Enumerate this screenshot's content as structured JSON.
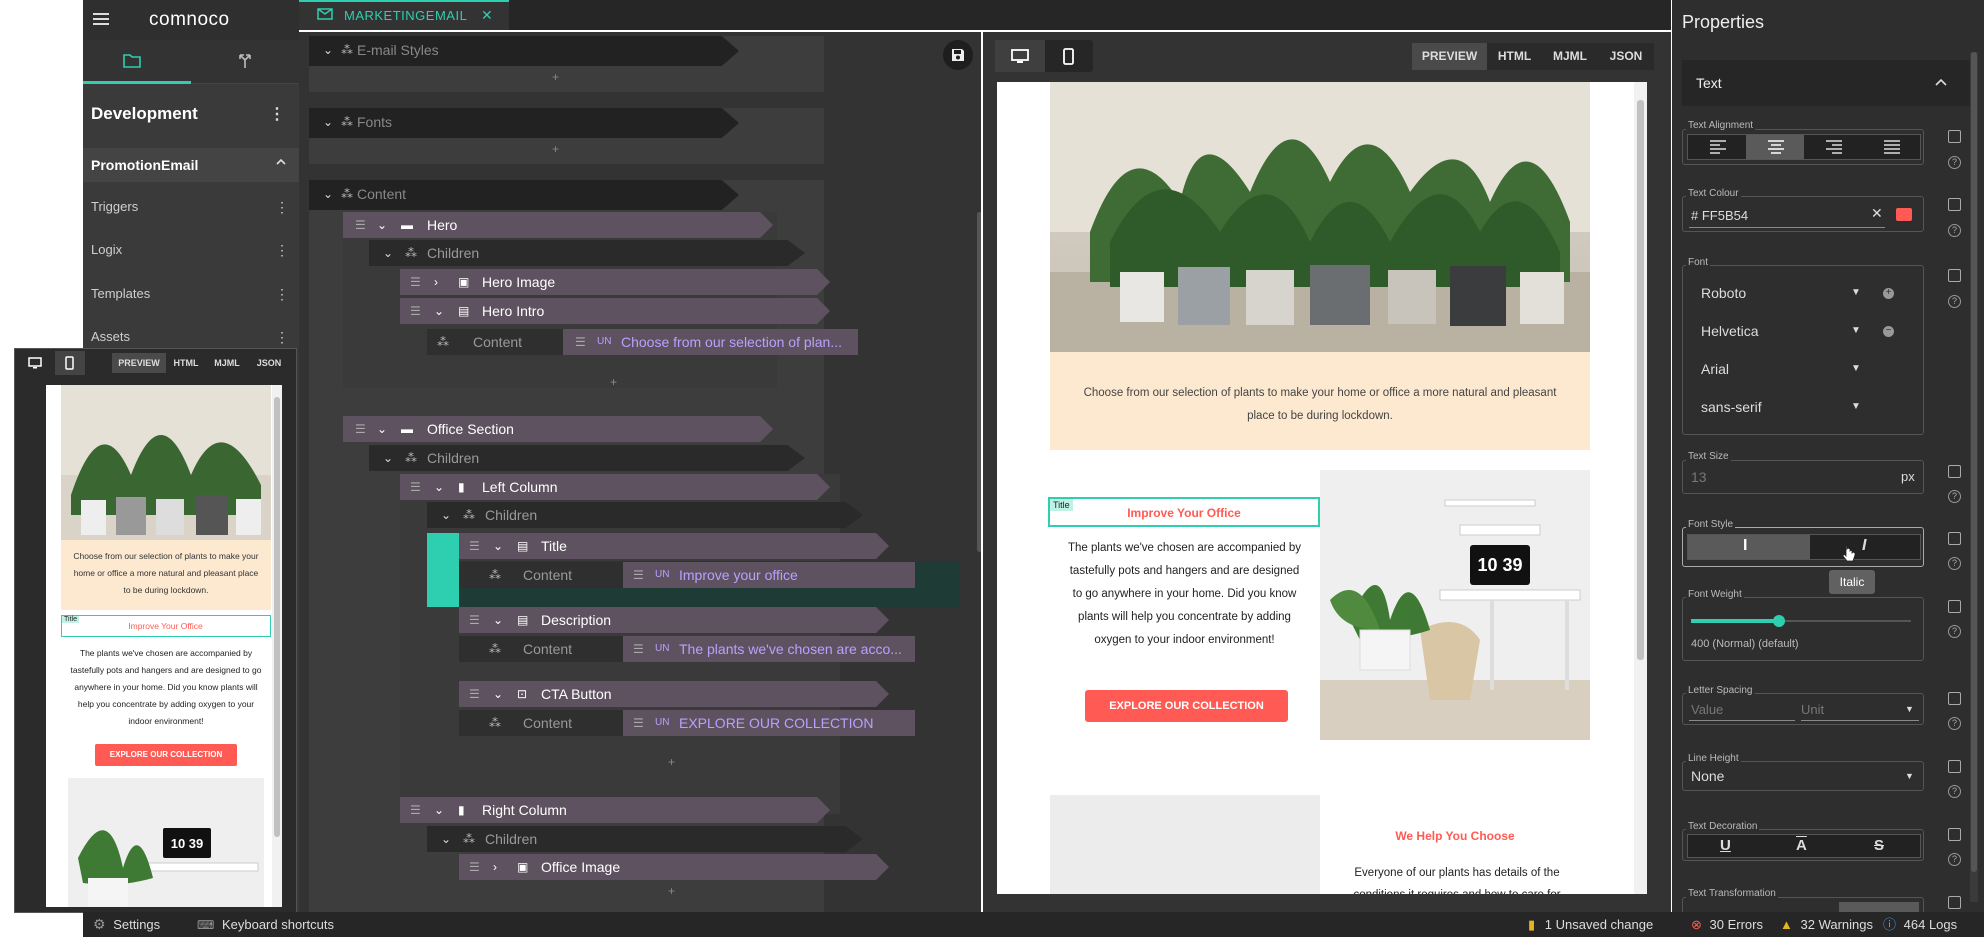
{
  "app": {
    "logo": "comnoco"
  },
  "sidebar": {
    "title": "Development",
    "section": "PromotionEmail",
    "items": [
      "Triggers",
      "Logix",
      "Templates",
      "Assets"
    ]
  },
  "editor_tab": {
    "label": "MARKETINGEMAIL"
  },
  "tree": {
    "groups": [
      "E-mail Styles",
      "Fonts",
      "Content"
    ],
    "nodes": {
      "hero": "Hero",
      "children": "Children",
      "hero_image": "Hero Image",
      "hero_intro": "Hero Intro",
      "content": "Content",
      "hero_intro_value": "Choose from our selection of plan...",
      "office_section": "Office Section",
      "left_column": "Left Column",
      "title": "Title",
      "title_value": "Improve your office",
      "description": "Description",
      "description_value": "The plants we've chosen are acco...",
      "cta_button": "CTA Button",
      "cta_value": "EXPLORE OUR COLLECTION",
      "right_column": "Right Column",
      "office_image": "Office Image"
    },
    "value_badge": "UN",
    "plus": "+"
  },
  "preview": {
    "view_tabs": [
      "PREVIEW",
      "HTML",
      "MJML",
      "JSON"
    ],
    "intro_text": "Choose from our selection of plants to make your home or office a more natural and pleasant place to be during lockdown.",
    "title_tag": "Title",
    "title": "Improve Your Office",
    "description": "The plants we've chosen are accompanied by tastefully pots and hangers and are designed to go anywhere in your home. Did you know plants will help you concentrate by adding oxygen to your indoor environment!",
    "cta": "EXPLORE OUR COLLECTION",
    "section2_title": "We Help You Choose",
    "section2_text": "Everyone of our plants has details of the conditions it requires and how to care for",
    "clock": "10 39"
  },
  "mini": {
    "view_tabs": [
      "PREVIEW",
      "HTML",
      "MJML",
      "JSON"
    ],
    "intro_text": "Choose from our selection of plants to make your home or office a more natural and pleasant place to be during lockdown.",
    "title_tag": "Title",
    "title": "Improve Your Office",
    "description": "The plants we've chosen are accompanied by tastefully pots and hangers and are designed to go anywhere in your home. Did you know plants will help you concentrate by adding oxygen to your indoor environment!",
    "cta": "EXPLORE OUR COLLECTION",
    "clock": "10 39"
  },
  "properties": {
    "title": "Properties",
    "section": "Text",
    "text_alignment_label": "Text Alignment",
    "text_colour_label": "Text Colour",
    "text_colour_value": "# FF5B54",
    "font_label": "Font",
    "fonts": [
      "Roboto",
      "Helvetica",
      "Arial",
      "sans-serif"
    ],
    "text_size_label": "Text Size",
    "text_size_placeholder": "13",
    "text_size_unit": "px",
    "font_style_label": "Font Style",
    "tooltip": "Italic",
    "font_weight_label": "Font Weight",
    "font_weight_value": "400 (Normal) (default)",
    "font_weight_level": 0.4,
    "letter_spacing_label": "Letter Spacing",
    "letter_spacing_value_placeholder": "Value",
    "letter_spacing_unit_placeholder": "Unit",
    "line_height_label": "Line Height",
    "line_height_value": "None",
    "text_decoration_label": "Text Decoration",
    "text_transformation_label": "Text Transformation"
  },
  "status": {
    "settings": "Settings",
    "shortcuts": "Keyboard shortcuts",
    "unsaved": "1 Unsaved change",
    "errors": "30 Errors",
    "warnings": "32 Warnings",
    "logs": "464 Logs"
  },
  "colors": {
    "accent": "#2ecfb0",
    "brand_red": "#ff5b54",
    "node": "#5f5260",
    "cream": "#fde9d0"
  },
  "icons": [
    "hamburger-icon",
    "folder-icon",
    "merge-icon",
    "more-vert-icon",
    "chevron-up-icon",
    "close-icon",
    "save-icon",
    "desktop-icon",
    "mobile-icon",
    "drag-handle-icon",
    "chevron-down-icon",
    "chevron-right-icon",
    "component-icon",
    "settings-icon",
    "keyboard-icon",
    "file-icon",
    "error-icon",
    "warning-icon",
    "info-icon"
  ]
}
